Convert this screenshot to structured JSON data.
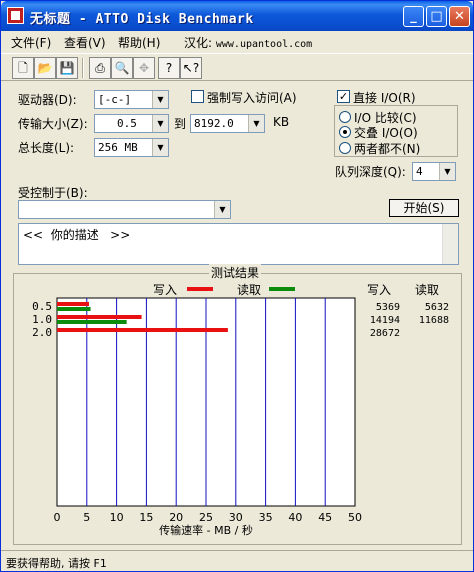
{
  "titlebar": {
    "title": "无标题 - ATTO Disk Benchmark",
    "min": "_",
    "max": "□",
    "close": "✕"
  },
  "menu": {
    "file": "文件(F)",
    "view": "查看(V)",
    "help": "帮助(H)",
    "localized_prefix": "汉化: ",
    "localized_url": "www.upantool.com"
  },
  "toolbar": {
    "icons": [
      "new-doc-icon",
      "open-folder-icon",
      "save-icon",
      "print-icon",
      "print-preview-icon",
      "move-icon",
      "help-icon",
      "context-help-icon"
    ]
  },
  "form": {
    "drive_label": "驱动器(D):",
    "drive_value": "[-c-]",
    "force_write_label": "强制写入访问(A)",
    "force_write_checked": false,
    "direct_io_label": "直接 I/O(R)",
    "direct_io_checked": true,
    "transfer_label": "传输大小(Z):",
    "transfer_from": "0.5",
    "to_label": "到",
    "transfer_to": "8192.0",
    "transfer_unit": "KB",
    "total_label": "总长度(L):",
    "total_value": "256 MB",
    "io_compare_label": "I/O 比较(C)",
    "overlapped_io_label": "交叠 I/O(O)",
    "neither_label": "两者都不(N)",
    "selected_mode": "overlapped",
    "queue_label": "队列深度(Q):",
    "queue_value": "4",
    "controlled_by_label": "受控制于(B):",
    "controlled_by_value": "",
    "start_button": "开始(S)",
    "description": "<<  你的描述   >>"
  },
  "results": {
    "title": "测试结果",
    "write_label": "写入",
    "read_label": "读取",
    "write_color": "#e81010",
    "read_color": "#0c8c0c",
    "col_write": "写入",
    "col_read": "读取",
    "rows": [
      {
        "size": "0.5",
        "write": "5369",
        "read": "5632"
      },
      {
        "size": "1.0",
        "write": "14194",
        "read": "11688"
      },
      {
        "size": "2.0",
        "write": "28672",
        "read": ""
      }
    ]
  },
  "chart_data": {
    "type": "bar",
    "orientation": "horizontal",
    "categories": [
      "0.5",
      "1.0",
      "2.0"
    ],
    "series": [
      {
        "name": "写入",
        "values": [
          5.369,
          14.194,
          28.672
        ]
      },
      {
        "name": "读取",
        "values": [
          5.632,
          11.688,
          null
        ]
      }
    ],
    "xlabel": "传输速率 - MB / 秒",
    "xlim": [
      0,
      50
    ],
    "xticks": [
      "0",
      "5",
      "10",
      "15",
      "20",
      "25",
      "30",
      "35",
      "40",
      "45",
      "50"
    ],
    "grid": true
  },
  "status": {
    "text": "要获得帮助, 请按 F1"
  }
}
